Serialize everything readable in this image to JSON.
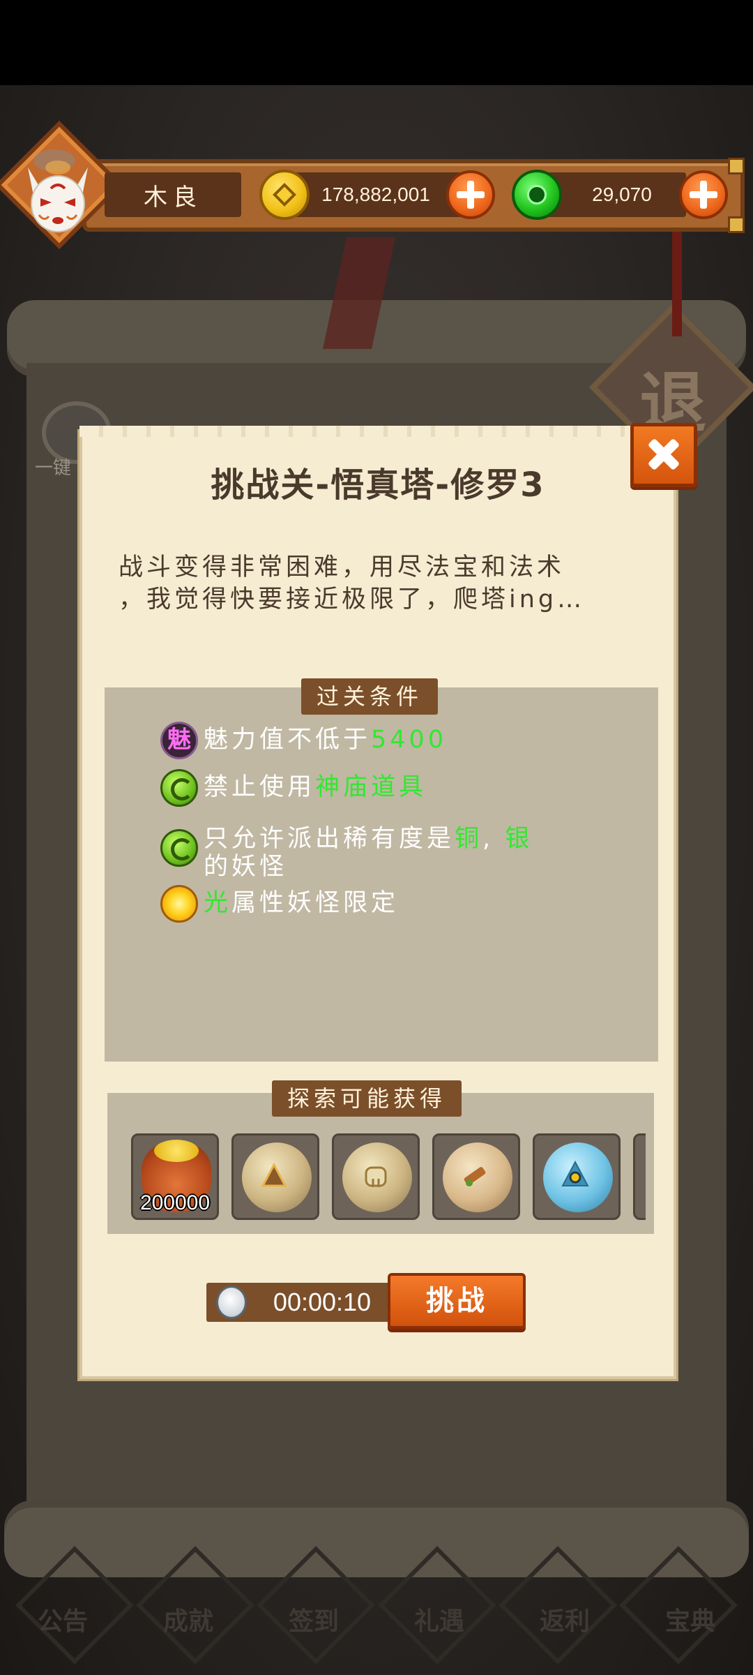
{
  "top_bar": {
    "player_name": "木良",
    "coins": "178,882,001",
    "jade": "29,070"
  },
  "dialog": {
    "title": "挑战关-悟真塔-修罗3",
    "description_line1": "战斗变得非常困难，用尽法宝和法术",
    "description_line2": "，我觉得快要接近极限了，爬塔ing…",
    "conditions_header": "过关条件",
    "conditions": [
      {
        "icon": "charm-icon",
        "icon_char": "魅",
        "text": "魅力值不低于",
        "highlight": "5400"
      },
      {
        "icon": "swirl-icon",
        "text": "禁止使用",
        "highlight": "神庙道具"
      },
      {
        "icon": "swirl-icon",
        "text": "只允许派出稀有度是",
        "highlight1": "铜",
        "sep": ",",
        "highlight2": "银",
        "text2": "的妖怪"
      },
      {
        "icon": "sun-icon",
        "highlight": "光",
        "text": "属性妖怪限定"
      }
    ],
    "loot_header": "探索可能获得",
    "loot": [
      {
        "icon": "gold-bag-icon",
        "count": "200000"
      },
      {
        "icon": "sand-orb-icon"
      },
      {
        "icon": "bell-orb-icon"
      },
      {
        "icon": "wood-orb-icon"
      },
      {
        "icon": "blue-eye-orb-icon"
      }
    ],
    "timer": "00:00:10",
    "challenge_label": "挑战"
  },
  "background": {
    "exit_label": "退",
    "onekey_label": "一键",
    "nav": [
      "公告",
      "成就",
      "签到",
      "礼遇",
      "返利",
      "宝典"
    ]
  },
  "colors": {
    "highlight_green": "#31e830",
    "button_orange": "#f06a1e",
    "panel_gray": "#c0b8a3",
    "tag_brown": "#7b4f2a",
    "paper": "#f6ecd2"
  }
}
